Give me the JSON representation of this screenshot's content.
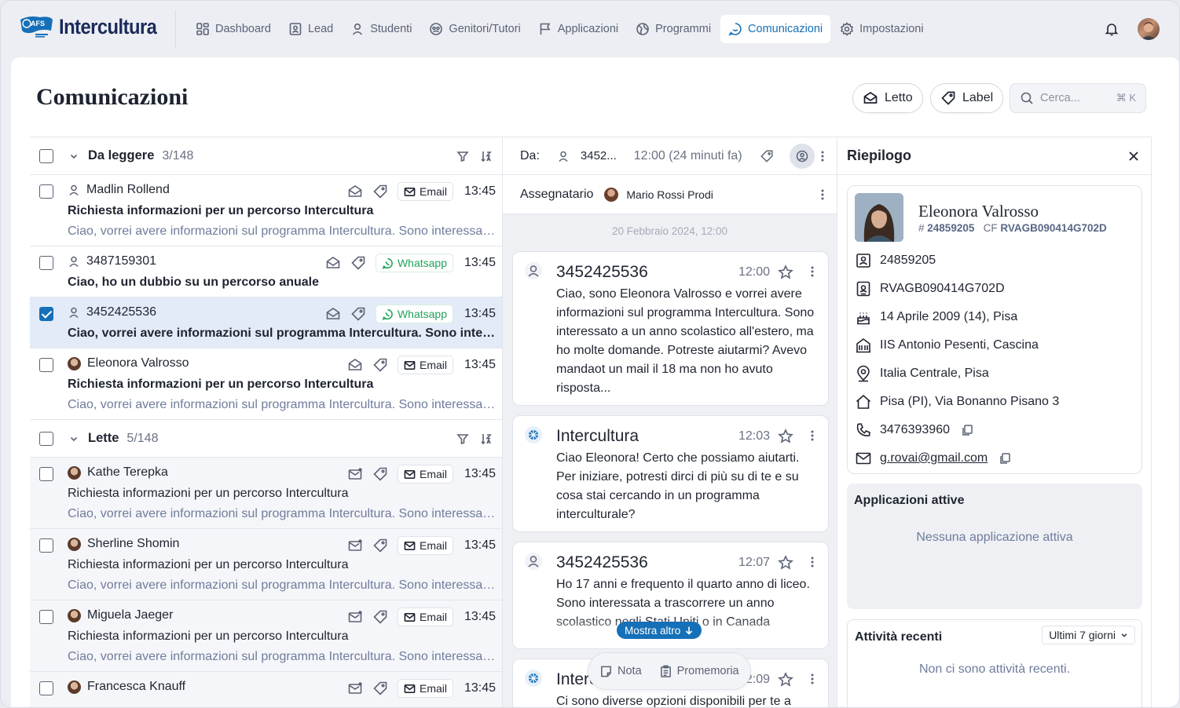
{
  "app": {
    "brand": "Intercultura",
    "badge": "AFS"
  },
  "nav": [
    {
      "label": "Dashboard",
      "icon": "dashboard-icon"
    },
    {
      "label": "Lead",
      "icon": "lead-icon"
    },
    {
      "label": "Studenti",
      "icon": "user-icon"
    },
    {
      "label": "Genitori/Tutori",
      "icon": "group-icon"
    },
    {
      "label": "Applicazioni",
      "icon": "flag-icon"
    },
    {
      "label": "Programmi",
      "icon": "globe-icon"
    },
    {
      "label": "Comunicazioni",
      "icon": "chat-icon",
      "active": true
    },
    {
      "label": "Impostazioni",
      "icon": "gear-icon"
    }
  ],
  "page": {
    "title": "Comunicazioni"
  },
  "toolbar": {
    "read_label": "Letto",
    "label_label": "Label",
    "search_placeholder": "Cerca...",
    "search_shortcut": "⌘ K"
  },
  "groups": {
    "unread": {
      "name": "Da leggere",
      "count": "3/148"
    },
    "read": {
      "name": "Lette",
      "count": "5/148"
    }
  },
  "messages_unread": [
    {
      "sender": "Madlin Rollend",
      "subject": "Richiesta informazioni per un percorso Intercultura",
      "preview": "Ciao, vorrei avere informazioni sul programma Intercultura. Sono interessato a un anno scolastico all'estero",
      "channel": "Email",
      "time": "13:45"
    },
    {
      "sender": "3487159301",
      "subject": "Ciao, ho un dubbio su un percorso anuale",
      "preview": "",
      "channel": "Whatsapp",
      "time": "13:45"
    },
    {
      "sender": "3452425536",
      "subject": "Ciao, vorrei avere informazioni sul programma Intercultura. Sono interessato a un anno scolastico",
      "preview": "",
      "channel": "Whatsapp",
      "time": "13:45"
    },
    {
      "sender": "Eleonora Valrosso",
      "subject": "Richiesta informazioni per un percorso Intercultura",
      "preview": "Ciao, vorrei avere informazioni sul programma Intercultura. Sono interessato a un anno scolastico all'estero",
      "channel": "Email",
      "time": "13:45"
    }
  ],
  "messages_read": [
    {
      "sender": "Kathe Terepka",
      "subject": "Richiesta informazioni per un percorso Intercultura",
      "preview": "Ciao, vorrei avere informazioni sul programma Intercultura. Sono interessato a un anno scolastico all'estero",
      "channel": "Email",
      "time": "13:45"
    },
    {
      "sender": "Sherline Shomin",
      "subject": "Richiesta informazioni per un percorso Intercultura",
      "preview": "Ciao, vorrei avere informazioni sul programma Intercultura. Sono interessato a un anno scolastico all'estero",
      "channel": "Email",
      "time": "13:45"
    },
    {
      "sender": "Miguela Jaeger",
      "subject": "Richiesta informazioni per un percorso Intercultura",
      "preview": "Ciao, vorrei avere informazioni sul programma Intercultura. Sono interessato a un anno scolastico all'estero",
      "channel": "Email",
      "time": "13:45"
    },
    {
      "sender": "Francesca Knauff",
      "subject": "",
      "preview": "",
      "channel": "Email",
      "time": "13:45"
    }
  ],
  "thread": {
    "from_label": "Da:",
    "from_value": "3452...",
    "from_time": "12:00 (24 minuti fa)",
    "assignee_label": "Assegnatario",
    "assignee_name": "Mario Rossi Prodi",
    "date_separator": "20 Febbraio 2024, 12:00",
    "messages": [
      {
        "sender": "3452425536",
        "time": "12:00",
        "text": "Ciao, sono Eleonora Valrosso e vorrei avere informazioni sul programma Intercultura. Sono interessato a un anno scolastico all'estero, ma ho molte domande. Potreste aiutarmi? Avevo mandaot un mail il 18 ma non ho avuto risposta..."
      },
      {
        "sender": "Intercultura",
        "time": "12:03",
        "text": "Ciao Eleonora! Certo che possiamo aiutarti. Per iniziare, potresti dirci di più su di te e su cosa stai cercando in un programma interculturale?"
      },
      {
        "sender": "3452425536",
        "time": "12:07",
        "text": "Ho 17 anni e frequento il quarto anno di liceo. Sono interessata a trascorrere un anno scolastico negli Stati Uniti o in Canada"
      },
      {
        "sender": "Intercultura",
        "time": "12:09",
        "text": "Ci sono diverse opzioni disponibili per te a"
      }
    ],
    "show_more": "Mostra altro",
    "note_label": "Nota",
    "reminder_label": "Promemoria"
  },
  "summary": {
    "title": "Riepilogo",
    "name": "Eleonora Valrosso",
    "id_prefix": "#",
    "id": "24859205",
    "cf_prefix": "CF",
    "cf": "RVAGB090414G702D",
    "rows": [
      {
        "icon": "id-card-icon",
        "text": "24859205"
      },
      {
        "icon": "badge-icon",
        "text": "RVAGB090414G702D"
      },
      {
        "icon": "cake-icon",
        "text": "14 Aprile 2009 (14), Pisa"
      },
      {
        "icon": "school-icon",
        "text": "IIS Antonio Pesenti, Cascina"
      },
      {
        "icon": "location-icon",
        "text": "Italia Centrale, Pisa"
      },
      {
        "icon": "home-icon",
        "text": "Pisa (PI), Via Bonanno Pisano 3"
      },
      {
        "icon": "phone-icon",
        "text": "3476393960"
      },
      {
        "icon": "mail-icon",
        "text": "g.rovai@gmail.com"
      }
    ],
    "apps_title": "Applicazioni attive",
    "apps_empty": "Nessuna applicazione attiva",
    "activity_title": "Attività recenti",
    "activity_range": "Ultimi 7 giorni",
    "activity_empty": "Non ci sono attività recenti."
  }
}
